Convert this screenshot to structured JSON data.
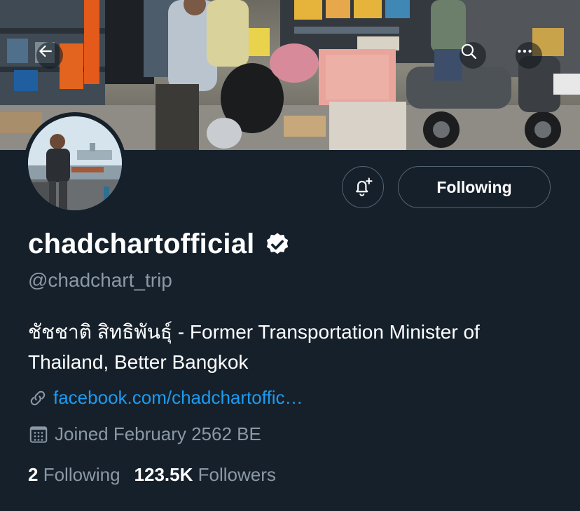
{
  "header": {
    "back_icon": "arrow-left-icon",
    "search_icon": "search-icon",
    "more_icon": "more-horizontal-icon"
  },
  "banner": {
    "description_icon": "banner-photo"
  },
  "profile": {
    "display_name": "chadchartofficial",
    "verified_icon": "verified-badge-icon",
    "handle": "@chadchart_trip",
    "bio": "ชัชชาติ สิทธิพันธุ์ - Former Transportation Minister of Thailand, Better Bangkok",
    "link": "facebook.com/chadchartoffic…",
    "joined": "Joined February 2562 BE"
  },
  "actions": {
    "notify_icon": "bell-plus-icon",
    "follow_label": "Following"
  },
  "stats": {
    "following_count": "2",
    "following_label": "Following",
    "followers_count": "123.5K",
    "followers_label": "Followers"
  },
  "colors": {
    "background": "#15202b",
    "secondary_text": "#8b98a5",
    "link": "#1d9bf0",
    "border": "#536471"
  }
}
